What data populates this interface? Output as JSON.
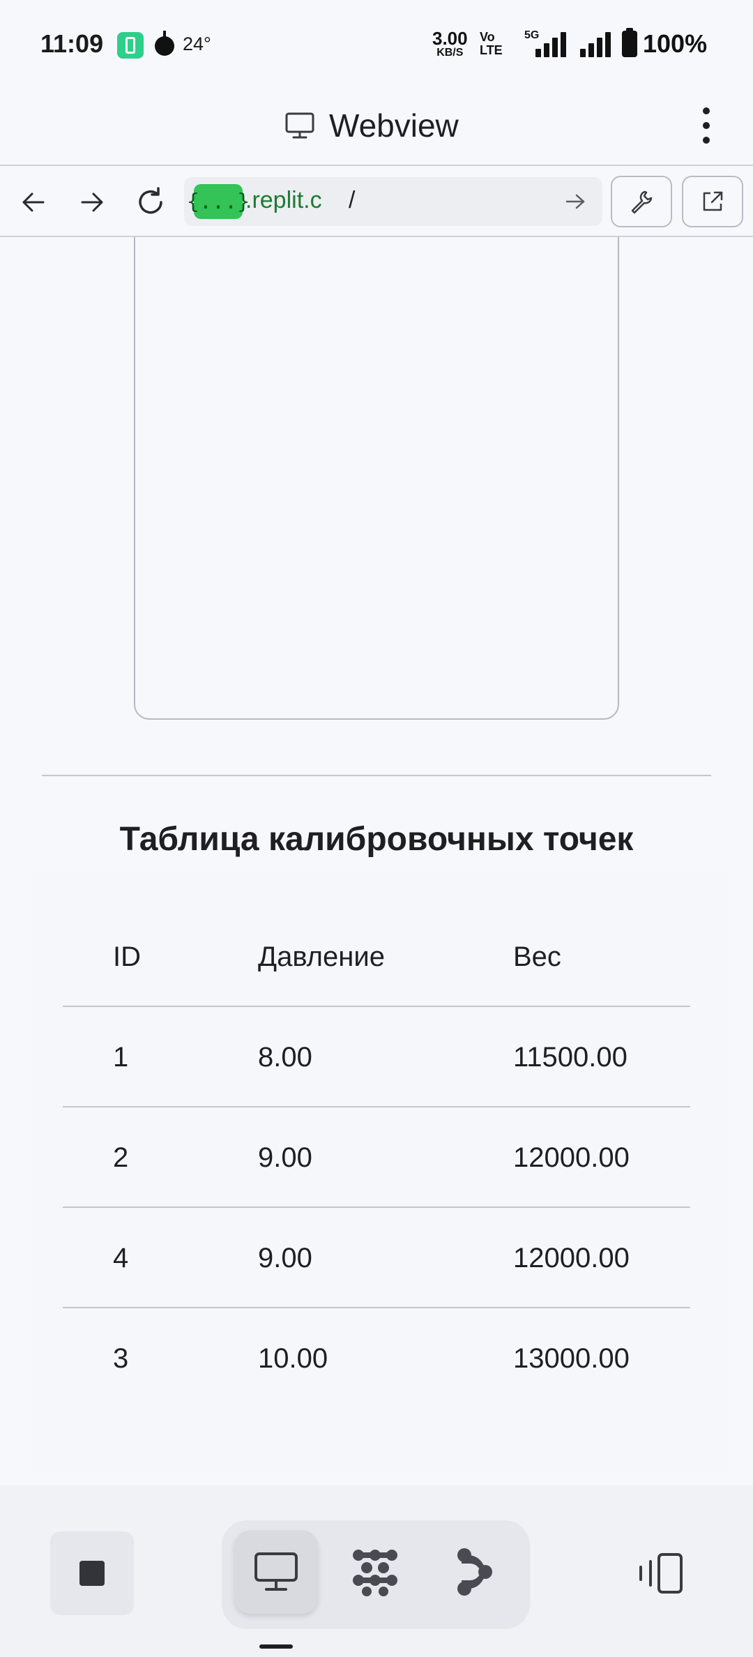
{
  "status_bar": {
    "time": "11:09",
    "temperature": "24°",
    "net_speed_value": "3.00",
    "net_speed_unit": "KB/S",
    "volte_top": "Vo",
    "volte_bottom": "LTE",
    "network": "5G",
    "battery": "100%"
  },
  "title_bar": {
    "title": "Webview",
    "monitor_icon": "monitor-icon",
    "menu_icon": "more-vert-icon"
  },
  "address_bar": {
    "back_icon": "arrow-left-icon",
    "forward_icon": "arrow-right-icon",
    "reload_icon": "reload-icon",
    "url_chip": "{...}",
    "url_host": ".replit.c",
    "url_path": "/",
    "go_icon": "arrow-right-icon",
    "tools_icon": "wrench-icon",
    "open_external_icon": "external-link-icon"
  },
  "content": {
    "section_title": "Таблица калибровочных точек",
    "table": {
      "headers": [
        "ID",
        "Давление",
        "Вес"
      ],
      "rows": [
        [
          "1",
          "8.00",
          "11500.00"
        ],
        [
          "2",
          "9.00",
          "12000.00"
        ],
        [
          "4",
          "9.00",
          "12000.00"
        ],
        [
          "3",
          "10.00",
          "13000.00"
        ]
      ]
    }
  },
  "bottom_bar": {
    "stop_icon": "stop-icon",
    "tabs": [
      "monitor-icon",
      "workflow-dots-icon",
      "git-branch-icon"
    ],
    "active_tab": 0,
    "devices_icon": "device-switch-icon"
  },
  "colors": {
    "background": "#f7f8fc",
    "url_chip": "#33c357",
    "url_host": "#1e7a32"
  }
}
